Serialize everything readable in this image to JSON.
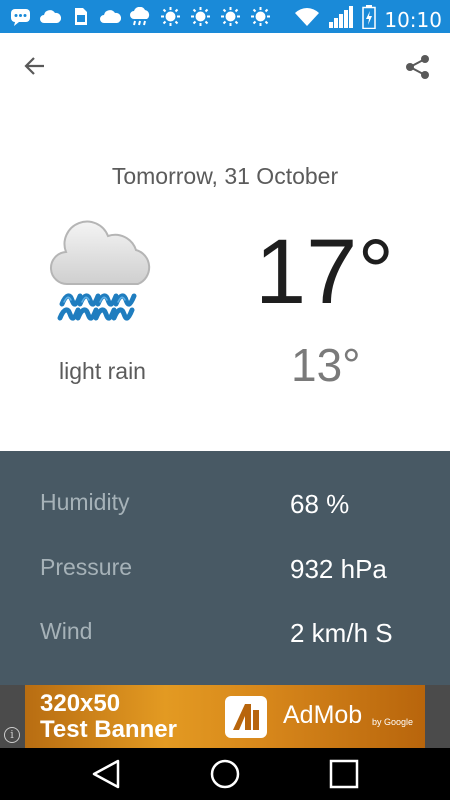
{
  "status_bar": {
    "time": "10:10",
    "icons_left": [
      "messaging-icon",
      "cloud-icon",
      "sim-icon",
      "cloud-icon",
      "rain-cloud-icon",
      "sun-icon",
      "sun-icon",
      "sun-icon",
      "sun-icon"
    ],
    "icons_right": [
      "wifi-icon",
      "signal-icon",
      "battery-charging-icon"
    ]
  },
  "app_bar": {
    "back_icon": "arrow-back-icon",
    "share_icon": "share-icon"
  },
  "forecast": {
    "date": "Tomorrow, 31 October",
    "condition": "light rain",
    "temp_high": "17°",
    "temp_low": "13°",
    "icon": "light-rain-icon"
  },
  "details": [
    {
      "label": "Humidity",
      "value": "68 %"
    },
    {
      "label": "Pressure",
      "value": "932 hPa"
    },
    {
      "label": "Wind",
      "value": "2 km/h S"
    }
  ],
  "ad": {
    "line1": "320x50",
    "line2": "Test Banner",
    "brand": "AdMob",
    "brand_sub": "by Google",
    "info_glyph": "i"
  },
  "colors": {
    "status_bar": "#1a8ad8",
    "details_bg": "#485964",
    "details_label": "#a6b2b8",
    "ad_orange": "#e39a22"
  }
}
